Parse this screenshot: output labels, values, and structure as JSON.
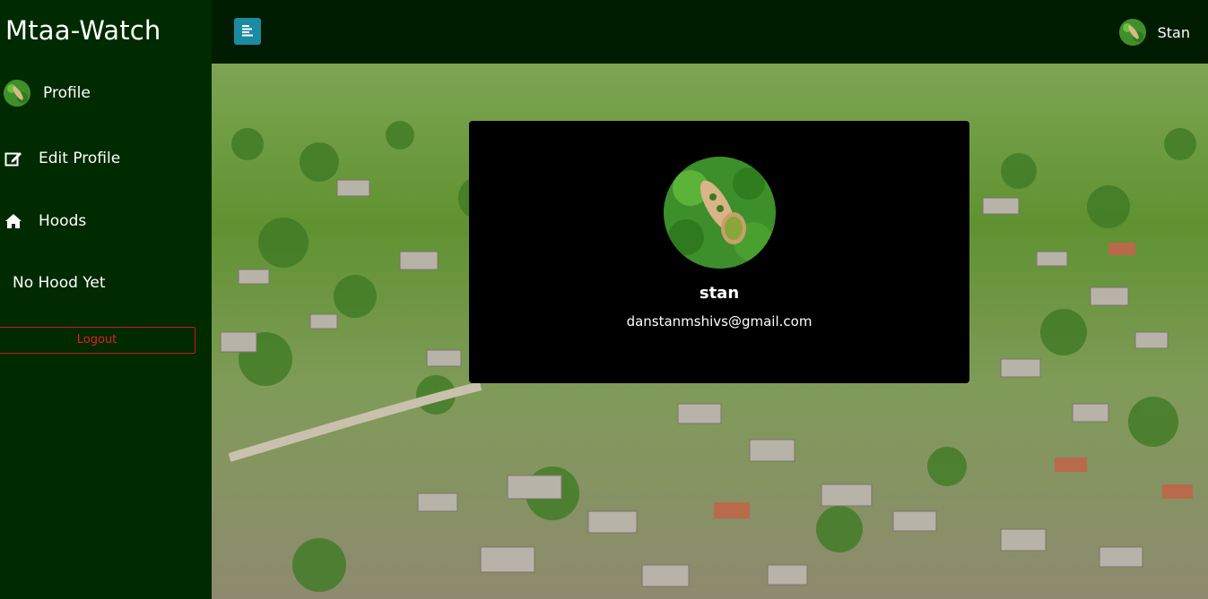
{
  "brand": "Mtaa-Watch",
  "sidebar": {
    "items": [
      {
        "label": "Profile",
        "icon": "avatar"
      },
      {
        "label": "Edit Profile",
        "icon": "edit-icon"
      },
      {
        "label": "Hoods",
        "icon": "home-icon"
      },
      {
        "label": "No Hood Yet"
      }
    ],
    "logout_label": "Logout"
  },
  "topbar": {
    "menu_icon": "menu-icon",
    "user_name": "Stan"
  },
  "profile_card": {
    "name": "stan",
    "email": "danstanmshivs@gmail.com"
  },
  "colors": {
    "sidebar_bg": "#002a00",
    "topbar_bg": "#001c00",
    "menu_button": "#1b8aa3",
    "logout": "#e02020",
    "card_bg": "#000000"
  }
}
